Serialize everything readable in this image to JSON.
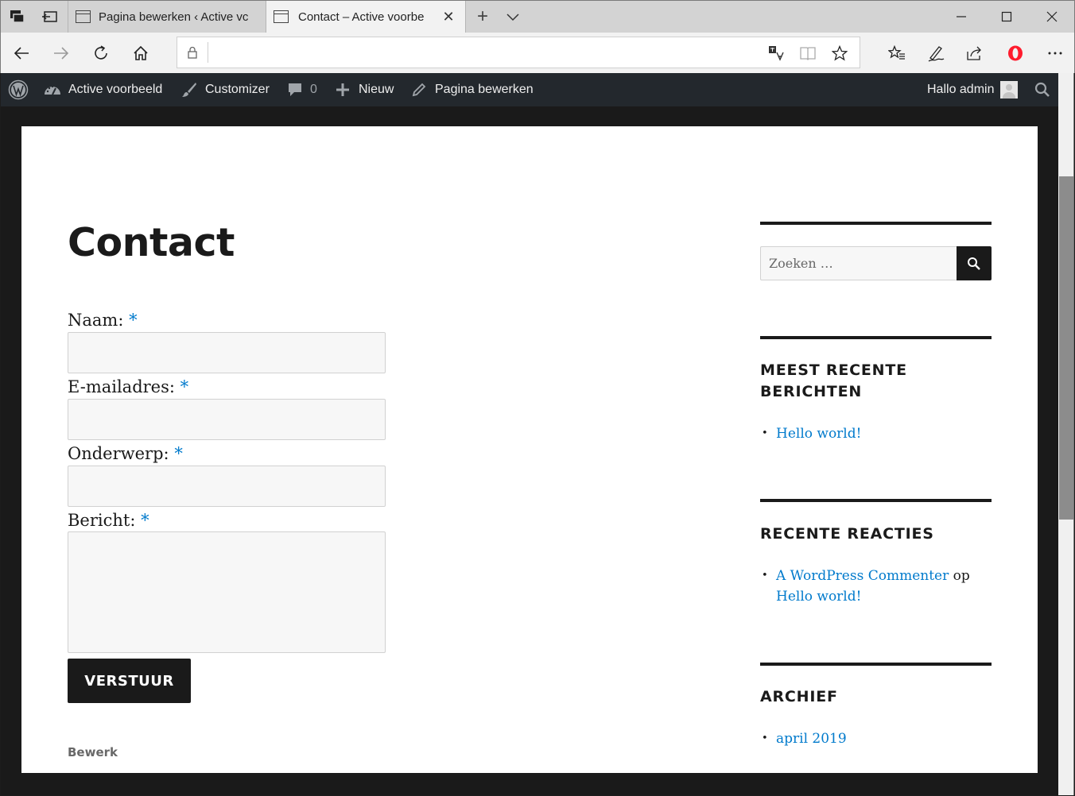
{
  "browser": {
    "tabs": [
      {
        "title": "Pagina bewerken ‹ Active vc",
        "active": false
      },
      {
        "title": "Contact – Active voorbe",
        "active": true
      }
    ],
    "address": {
      "url": ""
    }
  },
  "adminbar": {
    "site_name": "Active voorbeeld",
    "customizer": "Customizer",
    "comments_count": "0",
    "new": "Nieuw",
    "edit_page": "Pagina bewerken",
    "greeting": "Hallo admin"
  },
  "page": {
    "title": "Contact",
    "required_mark": "*",
    "fields": [
      {
        "label": "Naam:"
      },
      {
        "label": "E-mailadres:"
      },
      {
        "label": "Onderwerp:"
      },
      {
        "label": "Bericht:"
      }
    ],
    "submit_label": "VERSTUUR",
    "edit_link": "Bewerk"
  },
  "sidebar": {
    "search_placeholder": "Zoeken …",
    "recent_posts": {
      "title": "MEEST RECENTE BERICHTEN",
      "items": [
        "Hello world!"
      ]
    },
    "recent_comments": {
      "title": "RECENTE REACTIES",
      "author": "A WordPress Commenter",
      "connector": "op",
      "post": "Hello world!"
    },
    "archive": {
      "title": "ARCHIEF",
      "items": [
        "april 2019"
      ]
    }
  },
  "colors": {
    "link": "#007acc",
    "admin_bar": "#23282d",
    "text": "#1a1a1a",
    "opera_red": "#ff1b2d"
  }
}
